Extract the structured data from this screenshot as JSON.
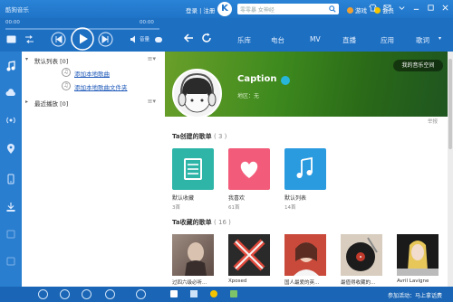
{
  "titlebar": {
    "app_name": "酷狗音乐",
    "user_links": "登录 | 注册",
    "logo_letter": "K",
    "search_value": "零零暴 女神经",
    "games": "游戏",
    "vip": "会员"
  },
  "player": {
    "time_elapsed": "00:00",
    "time_total": "00:00",
    "volume_label": "音量"
  },
  "nav": {
    "tabs": [
      "乐库",
      "电台",
      "MV",
      "直播",
      "应用",
      "歌词"
    ]
  },
  "playlist": {
    "default_list": "默认列表 [0]",
    "add_song": "添加本地歌曲",
    "add_folder": "添加本地歌曲文件夹",
    "recent": "最近播放 [0]"
  },
  "profile": {
    "username": "Caption",
    "region": "地区：无",
    "my_space_button": "我的音乐空间",
    "report": "举报"
  },
  "created_section": {
    "title": "Ta创建的歌单",
    "count": "( 3 )",
    "items": [
      {
        "title": "默认收藏",
        "songs": "3首",
        "color": "#2fb5a8"
      },
      {
        "title": "我喜欢",
        "songs": "61首",
        "color": "#f25c7a"
      },
      {
        "title": "默认列表",
        "songs": "14首",
        "color": "#2b9be0"
      }
    ]
  },
  "collected_section": {
    "title": "Ta收藏的歌单",
    "count": "( 16 )",
    "items": [
      {
        "title": "过四六级必听..."
      },
      {
        "title": "Xposed"
      },
      {
        "title": "国人最爱的英..."
      },
      {
        "title": "最值得收藏的..."
      },
      {
        "title": "Avril Lavigne"
      }
    ]
  },
  "statusbar": {
    "promo": "参加活动：马上拿话费"
  },
  "colors": {
    "brand_blue": "#1d6fc2",
    "link_blue": "#1d58b8",
    "banner_green": "#3e8a1e"
  }
}
